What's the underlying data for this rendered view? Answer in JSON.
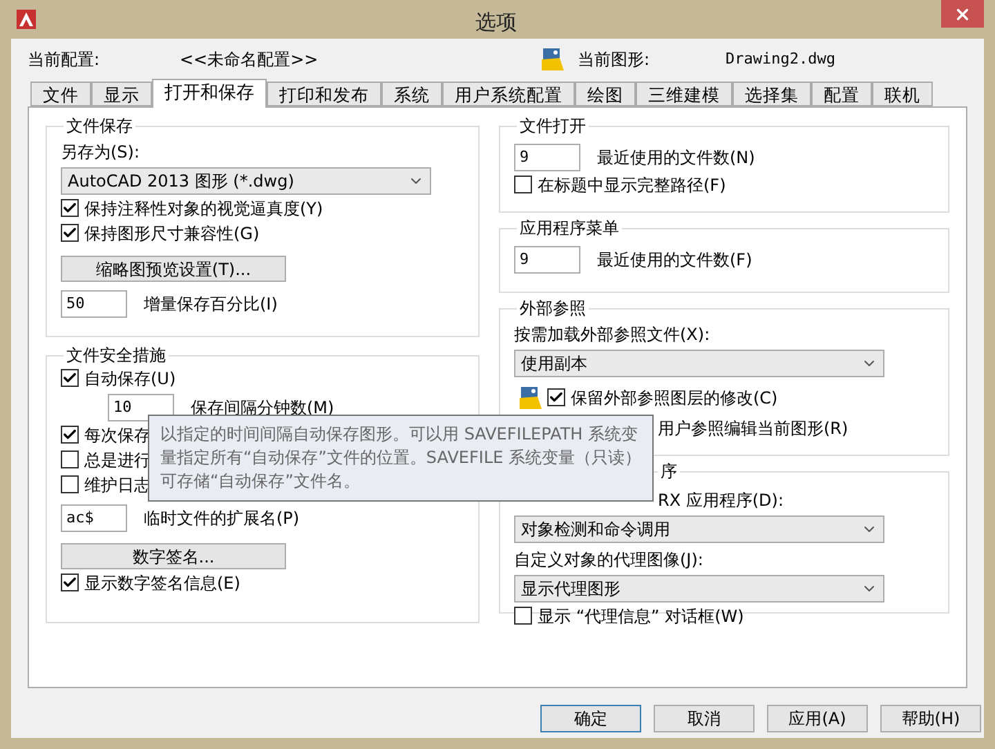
{
  "window": {
    "title": "选项"
  },
  "profile": {
    "label": "当前配置:",
    "value": "<<未命名配置>>"
  },
  "drawing": {
    "label": "当前图形:",
    "value": "Drawing2.dwg"
  },
  "tabs": [
    {
      "label": "文件",
      "selected": false
    },
    {
      "label": "显示",
      "selected": false
    },
    {
      "label": "打开和保存",
      "selected": true
    },
    {
      "label": "打印和发布",
      "selected": false
    },
    {
      "label": "系统",
      "selected": false
    },
    {
      "label": "用户系统配置",
      "selected": false
    },
    {
      "label": "绘图",
      "selected": false
    },
    {
      "label": "三维建模",
      "selected": false
    },
    {
      "label": "选择集",
      "selected": false
    },
    {
      "label": "配置",
      "selected": false
    },
    {
      "label": "联机",
      "selected": false
    }
  ],
  "left_groups": [
    {
      "title": "文件保存",
      "items": [
        {
          "kind": "label",
          "text": "另存为(S):"
        },
        {
          "kind": "select",
          "value": "AutoCAD 2013 图形 (*.dwg)"
        },
        {
          "kind": "checkbox",
          "label": "保持注释性对象的视觉逼真度(Y)",
          "checked": true
        },
        {
          "kind": "checkbox",
          "label": "保持图形尺寸兼容性(G)",
          "checked": true
        },
        {
          "kind": "button",
          "label": "缩略图预览设置(T)..."
        },
        {
          "kind": "input",
          "value": "50",
          "caption": "增量保存百分比(I)"
        }
      ]
    },
    {
      "title": "文件安全措施",
      "items": [
        {
          "kind": "checkbox",
          "label": "自动保存(U)",
          "checked": true
        },
        {
          "kind": "subinput",
          "value": "10",
          "caption": "保存间隔分钟数(M)"
        },
        {
          "kind": "checkbox",
          "label": "每次保存",
          "checked": true
        },
        {
          "kind": "checkbox",
          "label": "总是进行",
          "checked": false
        },
        {
          "kind": "checkbox",
          "label": "维护日志",
          "checked": false
        },
        {
          "kind": "input",
          "value": "ac$",
          "caption": "临时文件的扩展名(P)"
        },
        {
          "kind": "button",
          "label": "数字签名..."
        },
        {
          "kind": "checkbox",
          "label": "显示数字签名信息(E)",
          "checked": true
        }
      ]
    }
  ],
  "right_groups": [
    {
      "title": "文件打开",
      "items": [
        {
          "kind": "input",
          "value": "9",
          "caption": "最近使用的文件数(N)"
        },
        {
          "kind": "checkbox",
          "label": "在标题中显示完整路径(F)",
          "checked": false
        }
      ]
    },
    {
      "title": "应用程序菜单",
      "items": [
        {
          "kind": "input",
          "value": "9",
          "caption": "最近使用的文件数(F)"
        }
      ]
    },
    {
      "title": "外部参照",
      "items": [
        {
          "kind": "label",
          "text": "按需加载外部参照文件(X):"
        },
        {
          "kind": "select",
          "value": "使用副本"
        },
        {
          "kind": "iconcheckbox",
          "label": "保留外部参照图层的修改(C)",
          "checked": true
        },
        {
          "kind": "covered",
          "text": "用户参照编辑当前图形(R)"
        }
      ]
    },
    {
      "title": "序",
      "items": [
        {
          "kind": "covered",
          "text": "RX 应用程序(D):"
        },
        {
          "kind": "select",
          "value": "对象检测和命令调用"
        },
        {
          "kind": "label",
          "text": "自定义对象的代理图像(J):"
        },
        {
          "kind": "select",
          "value": "显示代理图形"
        },
        {
          "kind": "checkbox",
          "label": "显示 “代理信息” 对话框(W)",
          "checked": false
        }
      ]
    }
  ],
  "tooltip": {
    "lines": [
      "以指定的时间间隔自动保存图形。可以用 SAVEFILEPATH 系统变",
      "量指定所有“自动保存”文件的位置。SAVEFILE 系统变量（只读）",
      "可存储“自动保存”文件名。"
    ]
  },
  "buttons": [
    {
      "label": "确定",
      "default": true
    },
    {
      "label": "取消",
      "default": false
    },
    {
      "label": "应用(A)",
      "default": false
    },
    {
      "label": "帮助(H)",
      "default": false
    }
  ]
}
